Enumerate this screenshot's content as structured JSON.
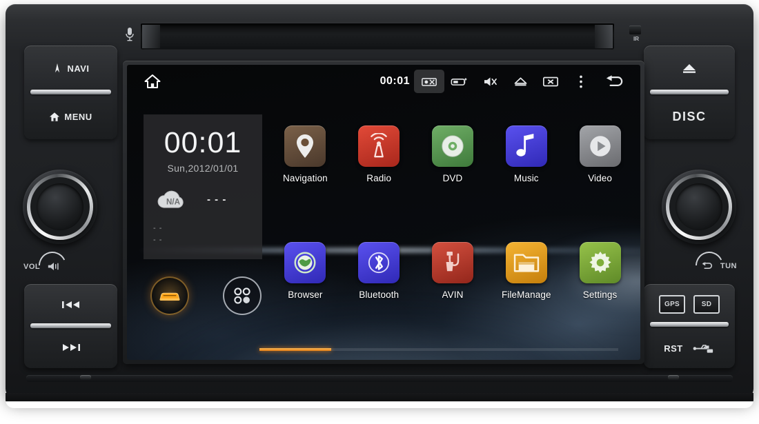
{
  "device": {
    "brand_style": "android-car-head-unit",
    "top_slot": {
      "mic_icon": "microphone-icon",
      "ir_label": "IR"
    }
  },
  "left_buttons": {
    "navi": {
      "label": "NAVI",
      "icon": "navi-compass-icon"
    },
    "menu": {
      "label": "MENU",
      "icon": "home-icon"
    },
    "vol": {
      "label": "VOL",
      "icon": "mute-speaker-icon"
    },
    "prev": {
      "label": "",
      "icon": "previous-track-icon"
    },
    "next": {
      "label": "",
      "icon": "next-track-icon"
    }
  },
  "right_buttons": {
    "eject": {
      "label": "",
      "icon": "eject-icon"
    },
    "disc": {
      "label": "DISC",
      "icon": ""
    },
    "tun": {
      "label": "TUN",
      "icon": "back-arrow-icon"
    },
    "gps": {
      "label": "GPS",
      "icon": "gps-card-icon"
    },
    "sd": {
      "label": "SD",
      "icon": "sd-card-icon"
    },
    "rst": {
      "label": "RST",
      "icon": ""
    },
    "usb": {
      "label": "USB",
      "icon": "usb-icon"
    }
  },
  "screen": {
    "statusbar": {
      "home_icon": "home-icon",
      "clock": "00:01",
      "icons": [
        {
          "name": "screenshot-icon",
          "active": true
        },
        {
          "name": "battery-charge-icon",
          "active": false
        },
        {
          "name": "volume-icon",
          "active": false
        },
        {
          "name": "eject-icon",
          "active": false
        },
        {
          "name": "screen-off-icon",
          "active": false
        },
        {
          "name": "overflow-menu-icon",
          "active": false
        },
        {
          "name": "back-arrow-icon",
          "active": false
        }
      ]
    },
    "clock_widget": {
      "time": "00:01",
      "date": "Sun,2012/01/01",
      "weather_icon": "cloud-icon",
      "weather_condition": "N/A",
      "temperature": "- - -",
      "detail_line_1": "- -",
      "detail_line_2": "- -"
    },
    "dock": [
      {
        "name": "car-mode-button",
        "icon": "car-icon"
      },
      {
        "name": "all-apps-button",
        "icon": "apps-grid-icon"
      }
    ],
    "apps": [
      {
        "label": "Navigation",
        "icon": "map-pin-icon",
        "color": "#6d5442",
        "color2": "#4a382b"
      },
      {
        "label": "Radio",
        "icon": "radio-wave-icon",
        "color": "#d8392b",
        "color2": "#a8271c"
      },
      {
        "label": "DVD",
        "icon": "disc-icon",
        "color": "#5c9b56",
        "color2": "#3f7a3b"
      },
      {
        "label": "Music",
        "icon": "music-note-icon",
        "color": "#4940e0",
        "color2": "#3029b6"
      },
      {
        "label": "Video",
        "icon": "play-circle-icon",
        "color": "#8f9094",
        "color2": "#6a6b6f"
      },
      {
        "label": "Browser",
        "icon": "globe-icon",
        "color": "#4940e0",
        "color2": "#3029b6"
      },
      {
        "label": "Bluetooth",
        "icon": "bluetooth-icon",
        "color": "#4940e0",
        "color2": "#3029b6"
      },
      {
        "label": "AVIN",
        "icon": "avin-icon",
        "color": "#c0392b",
        "color2": "#93261b"
      },
      {
        "label": "FileManage",
        "icon": "folder-icon",
        "color": "#e8a01c",
        "color2": "#c57f0c"
      },
      {
        "label": "Settings",
        "icon": "gear-icon",
        "color": "#7fae3a",
        "color2": "#5f8a28"
      }
    ],
    "pager": {
      "pages": 5,
      "current": 1
    }
  },
  "colors": {
    "accent": "#e07b14",
    "bezel": "#26282b",
    "screen_bg": "#07080a"
  }
}
